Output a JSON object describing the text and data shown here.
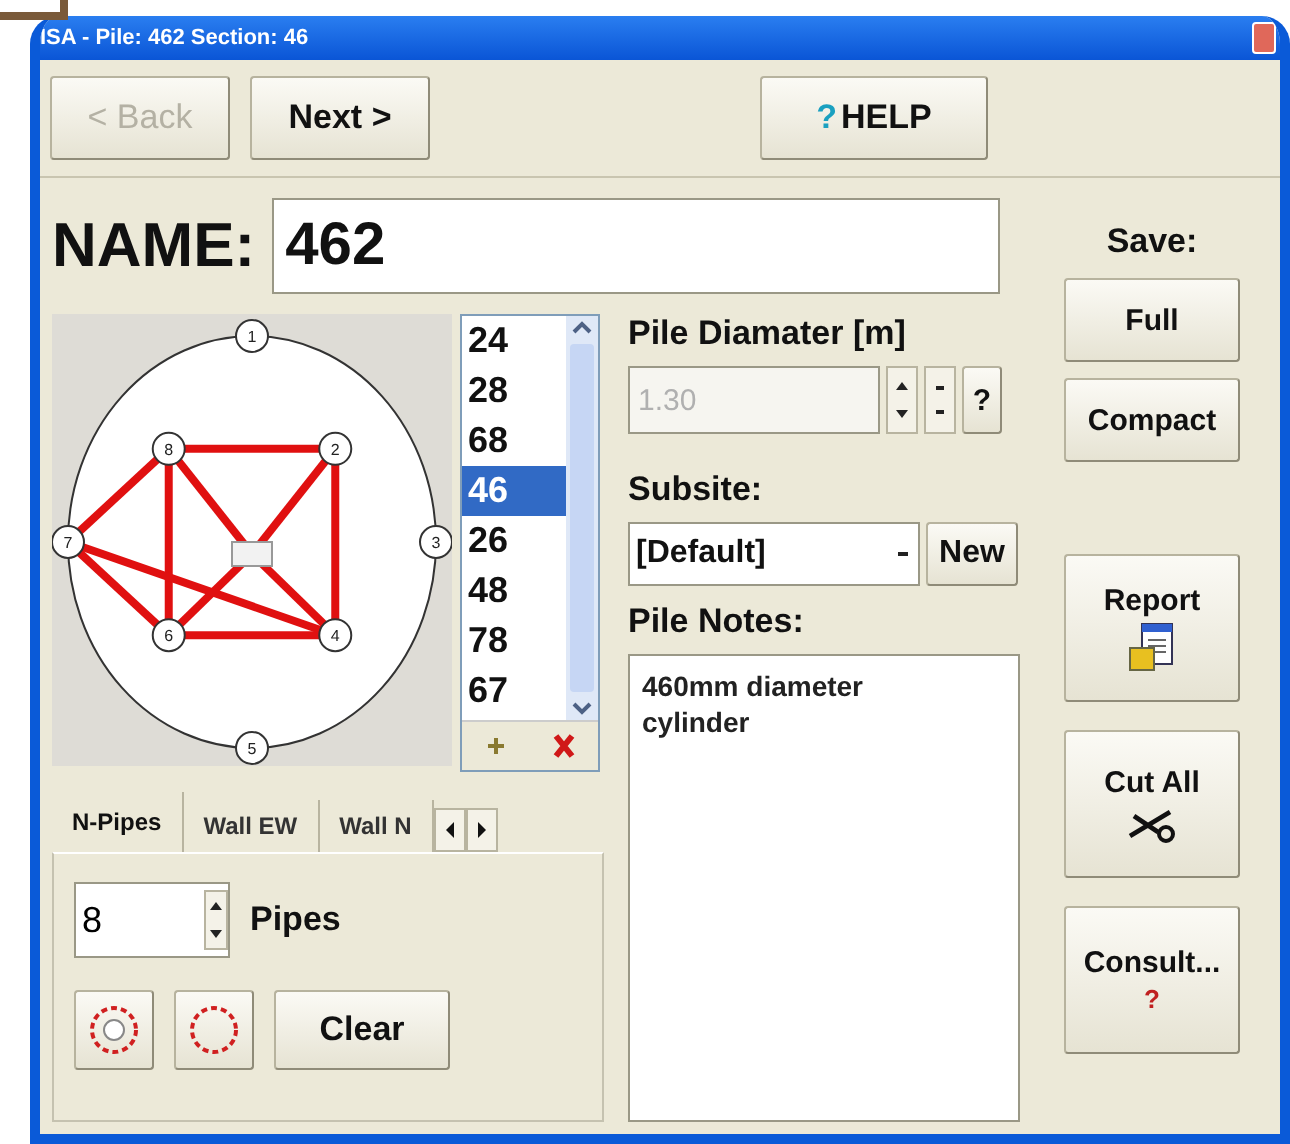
{
  "window": {
    "title": "ISA - Pile: 462  Section: 46"
  },
  "toolbar": [
    {
      "label": "< Back",
      "disabled": true
    },
    {
      "label": "Next >",
      "disabled": false
    }
  ],
  "help_button": {
    "icon": "?",
    "label": "HELP"
  },
  "name": {
    "label": "NAME:",
    "value": "462"
  },
  "diagram": {
    "nodes": [
      "1",
      "2",
      "3",
      "4",
      "5",
      "6",
      "7",
      "8"
    ]
  },
  "sections": [
    {
      "label": "24",
      "selected": false
    },
    {
      "label": "28",
      "selected": false
    },
    {
      "label": "68",
      "selected": false
    },
    {
      "label": "46",
      "selected": true
    },
    {
      "label": "26",
      "selected": false
    },
    {
      "label": "48",
      "selected": false
    },
    {
      "label": "78",
      "selected": false
    },
    {
      "label": "67",
      "selected": false
    }
  ],
  "tabs": [
    {
      "label": "N-Pipes",
      "selected": true
    },
    {
      "label": "Wall EW",
      "selected": false
    },
    {
      "label": "Wall N",
      "selected": false
    }
  ],
  "pipes": {
    "value": "8",
    "label": "Pipes"
  },
  "clear_button": "Clear",
  "diameter": {
    "label": "Pile Diamater [m]",
    "value": "1.30",
    "disabled": true,
    "help": "?"
  },
  "subsite": {
    "label": "Subsite:",
    "value": "[Default]",
    "new_button": "New"
  },
  "notes": {
    "label": "Pile Notes:",
    "value": "460mm diameter\ncylinder"
  },
  "save": {
    "label": "Save:",
    "buttons": [
      "Full",
      "Compact"
    ]
  },
  "actions": [
    {
      "label": "Report",
      "kind": "report"
    },
    {
      "label": "Cut All",
      "kind": "cut"
    },
    {
      "label": "Consult...",
      "kind": "consult",
      "mark": "?"
    }
  ]
}
